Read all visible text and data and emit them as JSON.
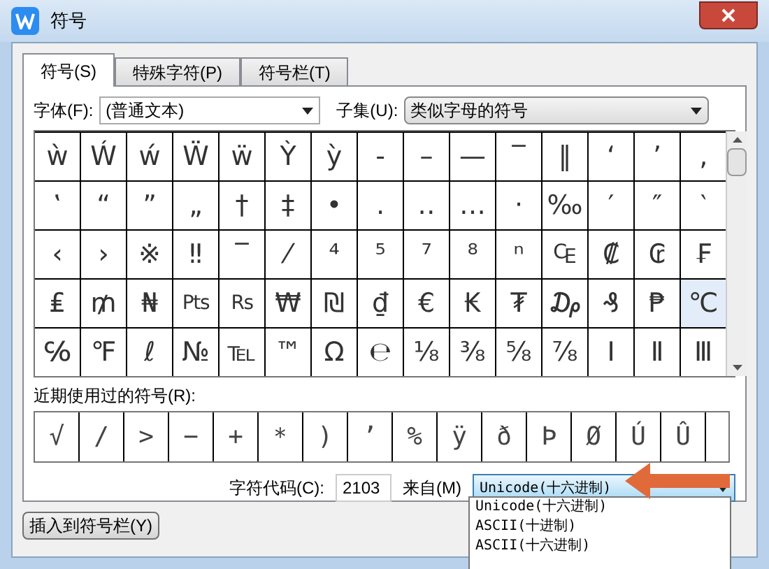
{
  "window": {
    "title": "符号"
  },
  "tabs": [
    {
      "label": "符号(S)",
      "selected": true
    },
    {
      "label": "特殊字符(P)",
      "selected": false
    },
    {
      "label": "符号栏(T)",
      "selected": false
    }
  ],
  "font": {
    "label": "字体(F):",
    "value": "(普通文本)"
  },
  "subset": {
    "label": "子集(U):",
    "value": "类似字母的符号"
  },
  "symbols": [
    [
      {
        "char": "ẁ",
        "selected": false
      },
      {
        "char": "Ẃ",
        "selected": false
      },
      {
        "char": "ẃ",
        "selected": false
      },
      {
        "char": "Ẅ",
        "selected": false
      },
      {
        "char": "ẅ",
        "selected": false
      },
      {
        "char": "Ỳ",
        "selected": false
      },
      {
        "char": "ỳ",
        "selected": false
      },
      {
        "char": "‐",
        "selected": false
      },
      {
        "char": "–",
        "selected": false
      },
      {
        "char": "—",
        "selected": false
      },
      {
        "char": "‾",
        "selected": false
      },
      {
        "char": "‖",
        "selected": false
      },
      {
        "char": "‘",
        "selected": false
      },
      {
        "char": "’",
        "selected": false
      },
      {
        "char": "‚",
        "selected": false
      }
    ],
    [
      {
        "char": "‛",
        "selected": false
      },
      {
        "char": "“",
        "selected": false
      },
      {
        "char": "”",
        "selected": false
      },
      {
        "char": "„",
        "selected": false
      },
      {
        "char": "†",
        "selected": false
      },
      {
        "char": "‡",
        "selected": false
      },
      {
        "char": "•",
        "selected": false
      },
      {
        "char": "․",
        "selected": false
      },
      {
        "char": "‥",
        "selected": false
      },
      {
        "char": "…",
        "selected": false
      },
      {
        "char": "‧",
        "selected": false
      },
      {
        "char": "‰",
        "selected": false
      },
      {
        "char": "′",
        "selected": false
      },
      {
        "char": "″",
        "selected": false
      },
      {
        "char": "‵",
        "selected": false
      }
    ],
    [
      {
        "char": "‹",
        "selected": false
      },
      {
        "char": "›",
        "selected": false
      },
      {
        "char": "※",
        "selected": false
      },
      {
        "char": "‼",
        "selected": false
      },
      {
        "char": "‾",
        "selected": false
      },
      {
        "char": "⁄",
        "selected": false
      },
      {
        "char": "⁴",
        "selected": false
      },
      {
        "char": "⁵",
        "selected": false
      },
      {
        "char": "⁷",
        "selected": false
      },
      {
        "char": "⁸",
        "selected": false
      },
      {
        "char": "ⁿ",
        "selected": false
      },
      {
        "char": "₠",
        "selected": false
      },
      {
        "char": "₡",
        "selected": false
      },
      {
        "char": "₢",
        "selected": false
      },
      {
        "char": "₣",
        "selected": false
      }
    ],
    [
      {
        "char": "₤",
        "selected": false
      },
      {
        "char": "₥",
        "selected": false
      },
      {
        "char": "₦",
        "selected": false
      },
      {
        "char": "Pts",
        "selected": false
      },
      {
        "char": "Rs",
        "selected": false
      },
      {
        "char": "₩",
        "selected": false
      },
      {
        "char": "₪",
        "selected": false
      },
      {
        "char": "₫",
        "selected": false
      },
      {
        "char": "€",
        "selected": false
      },
      {
        "char": "₭",
        "selected": false
      },
      {
        "char": "₮",
        "selected": false
      },
      {
        "char": "₯",
        "selected": false
      },
      {
        "char": "₰",
        "selected": false
      },
      {
        "char": "₱",
        "selected": false
      },
      {
        "char": "℃",
        "selected": true
      }
    ],
    [
      {
        "char": "℅",
        "selected": false
      },
      {
        "char": "℉",
        "selected": false
      },
      {
        "char": "ℓ",
        "selected": false
      },
      {
        "char": "№",
        "selected": false
      },
      {
        "char": "℡",
        "selected": false
      },
      {
        "char": "™",
        "selected": false
      },
      {
        "char": "Ω",
        "selected": false
      },
      {
        "char": "℮",
        "selected": false
      },
      {
        "char": "⅛",
        "selected": false
      },
      {
        "char": "⅜",
        "selected": false
      },
      {
        "char": "⅝",
        "selected": false
      },
      {
        "char": "⅞",
        "selected": false
      },
      {
        "char": "Ⅰ",
        "selected": false
      },
      {
        "char": "Ⅱ",
        "selected": false
      },
      {
        "char": "Ⅲ",
        "selected": false
      }
    ]
  ],
  "recent": {
    "label": "近期使用过的符号(R):",
    "symbols": [
      "√",
      "/",
      ">",
      "−",
      "+",
      "＊",
      ")",
      "’",
      "%",
      "ÿ",
      "ð",
      "Þ",
      "Ø",
      "Ú",
      "Û"
    ]
  },
  "code": {
    "label": "字符代码(C):",
    "value": "2103"
  },
  "from": {
    "label": "来自(M)",
    "value": "Unicode(十六进制)",
    "options": [
      "Unicode(十六进制)",
      "ASCII(十进制)",
      "ASCII(十六进制)"
    ]
  },
  "insert_button": "插入到符号栏(Y)"
}
